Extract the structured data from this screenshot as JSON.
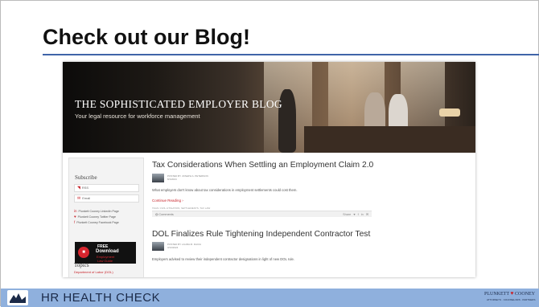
{
  "slide": {
    "title": "Check out our Blog!",
    "footer_title": "HR HEALTH CHECK",
    "firm_name_left": "PLUNKETT",
    "firm_name_right": "COONEY",
    "firm_tagline": "ATTORNEYS · COUNSELORS · PARTNERS"
  },
  "blog": {
    "header_title": "THE SOPHISTICATED EMPLOYER BLOG",
    "header_subtitle": "Your legal resource for workforce management",
    "sidebar": {
      "subscribe_heading": "Subscribe",
      "rss_label": "RSS",
      "email_label": "Email",
      "social_links": [
        "Plunkett Cooney LinkedIn Page",
        "Plunkett Cooney Twitter Page",
        "Plunkett Cooney Facebook Page"
      ],
      "promo": {
        "line1": "FREE",
        "line2": "Download",
        "line3": "Employment",
        "line4": "Law Guide"
      },
      "topics_heading": "Topics",
      "topic_first": "Department of Labor (DOL)"
    },
    "posts": [
      {
        "title": "Tax Considerations When Settling an Employment Claim 2.0",
        "author_line": "POSTED BY JOSEPH A. PETERSON",
        "date": "8/1/2024",
        "excerpt": "What employers don't know about tax considerations in employment settlements could cost them.",
        "read_more": "Continue Reading ›",
        "tags": "TAGS: CIVIL LITIGATION, SETTLEMENTS, TAX LAW",
        "comments": "Comments",
        "share_label": "Share"
      },
      {
        "title": "DOL Finalizes Rule Tightening Independent Contractor Test",
        "author_line": "POSTED BY LAURA M. DACIA",
        "date": "3/13/2024",
        "excerpt": "Employers advised to review their independent contractor designations in light of new DOL rule."
      }
    ]
  },
  "colors": {
    "accent_red": "#c8242b",
    "title_rule_blue": "#3f64a8",
    "footer_band": "#8fb0dd",
    "footer_text": "#1b2a48"
  },
  "icons": [
    "rss-icon",
    "email-icon",
    "linkedin-icon",
    "twitter-icon",
    "facebook-icon",
    "download-pdf-icon",
    "comment-icon",
    "twitter-share-icon",
    "facebook-share-icon",
    "linkedin-share-icon",
    "email-share-icon",
    "health-check-logo-icon"
  ]
}
